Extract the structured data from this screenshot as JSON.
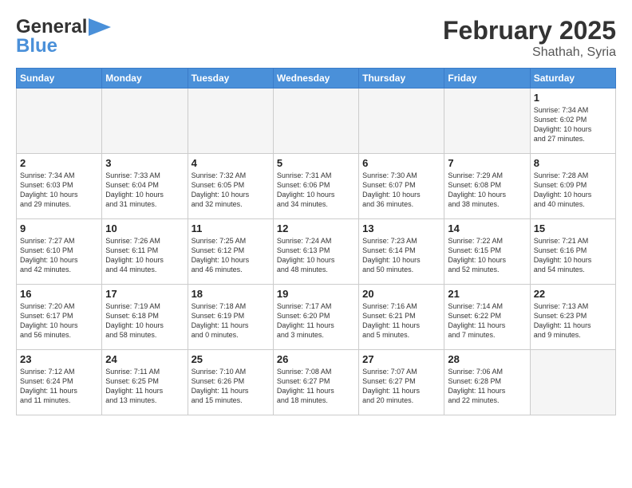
{
  "header": {
    "logo_general": "General",
    "logo_blue": "Blue",
    "month_title": "February 2025",
    "location": "Shathah, Syria"
  },
  "weekdays": [
    "Sunday",
    "Monday",
    "Tuesday",
    "Wednesday",
    "Thursday",
    "Friday",
    "Saturday"
  ],
  "weeks": [
    [
      {
        "day": "",
        "info": ""
      },
      {
        "day": "",
        "info": ""
      },
      {
        "day": "",
        "info": ""
      },
      {
        "day": "",
        "info": ""
      },
      {
        "day": "",
        "info": ""
      },
      {
        "day": "",
        "info": ""
      },
      {
        "day": "1",
        "info": "Sunrise: 7:34 AM\nSunset: 6:02 PM\nDaylight: 10 hours\nand 27 minutes."
      }
    ],
    [
      {
        "day": "2",
        "info": "Sunrise: 7:34 AM\nSunset: 6:03 PM\nDaylight: 10 hours\nand 29 minutes."
      },
      {
        "day": "3",
        "info": "Sunrise: 7:33 AM\nSunset: 6:04 PM\nDaylight: 10 hours\nand 31 minutes."
      },
      {
        "day": "4",
        "info": "Sunrise: 7:32 AM\nSunset: 6:05 PM\nDaylight: 10 hours\nand 32 minutes."
      },
      {
        "day": "5",
        "info": "Sunrise: 7:31 AM\nSunset: 6:06 PM\nDaylight: 10 hours\nand 34 minutes."
      },
      {
        "day": "6",
        "info": "Sunrise: 7:30 AM\nSunset: 6:07 PM\nDaylight: 10 hours\nand 36 minutes."
      },
      {
        "day": "7",
        "info": "Sunrise: 7:29 AM\nSunset: 6:08 PM\nDaylight: 10 hours\nand 38 minutes."
      },
      {
        "day": "8",
        "info": "Sunrise: 7:28 AM\nSunset: 6:09 PM\nDaylight: 10 hours\nand 40 minutes."
      }
    ],
    [
      {
        "day": "9",
        "info": "Sunrise: 7:27 AM\nSunset: 6:10 PM\nDaylight: 10 hours\nand 42 minutes."
      },
      {
        "day": "10",
        "info": "Sunrise: 7:26 AM\nSunset: 6:11 PM\nDaylight: 10 hours\nand 44 minutes."
      },
      {
        "day": "11",
        "info": "Sunrise: 7:25 AM\nSunset: 6:12 PM\nDaylight: 10 hours\nand 46 minutes."
      },
      {
        "day": "12",
        "info": "Sunrise: 7:24 AM\nSunset: 6:13 PM\nDaylight: 10 hours\nand 48 minutes."
      },
      {
        "day": "13",
        "info": "Sunrise: 7:23 AM\nSunset: 6:14 PM\nDaylight: 10 hours\nand 50 minutes."
      },
      {
        "day": "14",
        "info": "Sunrise: 7:22 AM\nSunset: 6:15 PM\nDaylight: 10 hours\nand 52 minutes."
      },
      {
        "day": "15",
        "info": "Sunrise: 7:21 AM\nSunset: 6:16 PM\nDaylight: 10 hours\nand 54 minutes."
      }
    ],
    [
      {
        "day": "16",
        "info": "Sunrise: 7:20 AM\nSunset: 6:17 PM\nDaylight: 10 hours\nand 56 minutes."
      },
      {
        "day": "17",
        "info": "Sunrise: 7:19 AM\nSunset: 6:18 PM\nDaylight: 10 hours\nand 58 minutes."
      },
      {
        "day": "18",
        "info": "Sunrise: 7:18 AM\nSunset: 6:19 PM\nDaylight: 11 hours\nand 0 minutes."
      },
      {
        "day": "19",
        "info": "Sunrise: 7:17 AM\nSunset: 6:20 PM\nDaylight: 11 hours\nand 3 minutes."
      },
      {
        "day": "20",
        "info": "Sunrise: 7:16 AM\nSunset: 6:21 PM\nDaylight: 11 hours\nand 5 minutes."
      },
      {
        "day": "21",
        "info": "Sunrise: 7:14 AM\nSunset: 6:22 PM\nDaylight: 11 hours\nand 7 minutes."
      },
      {
        "day": "22",
        "info": "Sunrise: 7:13 AM\nSunset: 6:23 PM\nDaylight: 11 hours\nand 9 minutes."
      }
    ],
    [
      {
        "day": "23",
        "info": "Sunrise: 7:12 AM\nSunset: 6:24 PM\nDaylight: 11 hours\nand 11 minutes."
      },
      {
        "day": "24",
        "info": "Sunrise: 7:11 AM\nSunset: 6:25 PM\nDaylight: 11 hours\nand 13 minutes."
      },
      {
        "day": "25",
        "info": "Sunrise: 7:10 AM\nSunset: 6:26 PM\nDaylight: 11 hours\nand 15 minutes."
      },
      {
        "day": "26",
        "info": "Sunrise: 7:08 AM\nSunset: 6:27 PM\nDaylight: 11 hours\nand 18 minutes."
      },
      {
        "day": "27",
        "info": "Sunrise: 7:07 AM\nSunset: 6:27 PM\nDaylight: 11 hours\nand 20 minutes."
      },
      {
        "day": "28",
        "info": "Sunrise: 7:06 AM\nSunset: 6:28 PM\nDaylight: 11 hours\nand 22 minutes."
      },
      {
        "day": "",
        "info": ""
      }
    ]
  ]
}
